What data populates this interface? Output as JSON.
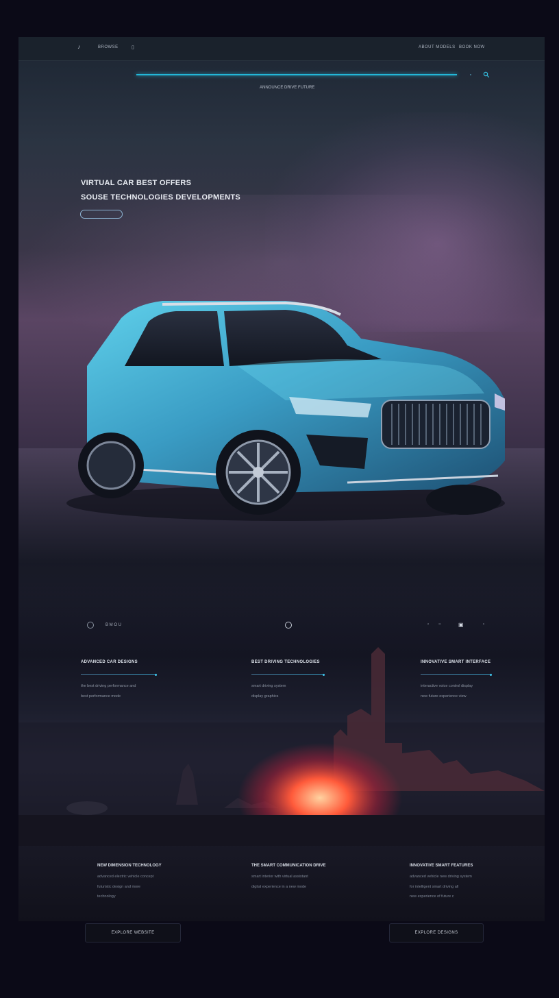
{
  "nav": {
    "logo": "♪",
    "left_link": "BROWSE",
    "menu_mark": "▯",
    "right_links": [
      "ABOUT MODELS",
      "BOOK NOW"
    ]
  },
  "search": {
    "caption": "ANNOUNCE DRIVE FUTURE"
  },
  "hero": {
    "line1": "VIRTUAL CAR BEST OFFERS",
    "line2": "SOUSE TECHNOLOGIES DEVELOPMENTS",
    "accent": "#23b7d8"
  },
  "controls": {
    "left_label": "B M O U",
    "pager": [
      "‹",
      "○",
      "▣",
      "›"
    ]
  },
  "features": [
    {
      "title": "ADVANCED CAR DESIGNS",
      "lines": [
        "the best driving performance and",
        "best performance mode"
      ]
    },
    {
      "title": "BEST DRIVING TECHNOLOGIES",
      "lines": [
        "smart driving system",
        "display graphics"
      ]
    },
    {
      "title": "INNOVATIVE SMART INTERFACE",
      "lines": [
        "interactive voice control display",
        "new future experience view"
      ]
    }
  ],
  "bottom": [
    {
      "title": "NEW DIMENSION TECHNOLOGY",
      "lines": [
        "advanced electric vehicle concept",
        "futuristic design and more",
        "technology"
      ]
    },
    {
      "title": "THE SMART COMMUNICATION DRIVE",
      "lines": [
        "smart interior with virtual assistant",
        "digital experience in a new mode"
      ]
    },
    {
      "title": "INNOVATIVE SMART FEATURES",
      "lines": [
        "advanced vehicle new driving system",
        "for intelligent smart driving all",
        "new experience of future c"
      ]
    }
  ],
  "buttons": {
    "left": "EXPLORE WEBSITE",
    "right": "EXPLORE DESIGNS"
  }
}
